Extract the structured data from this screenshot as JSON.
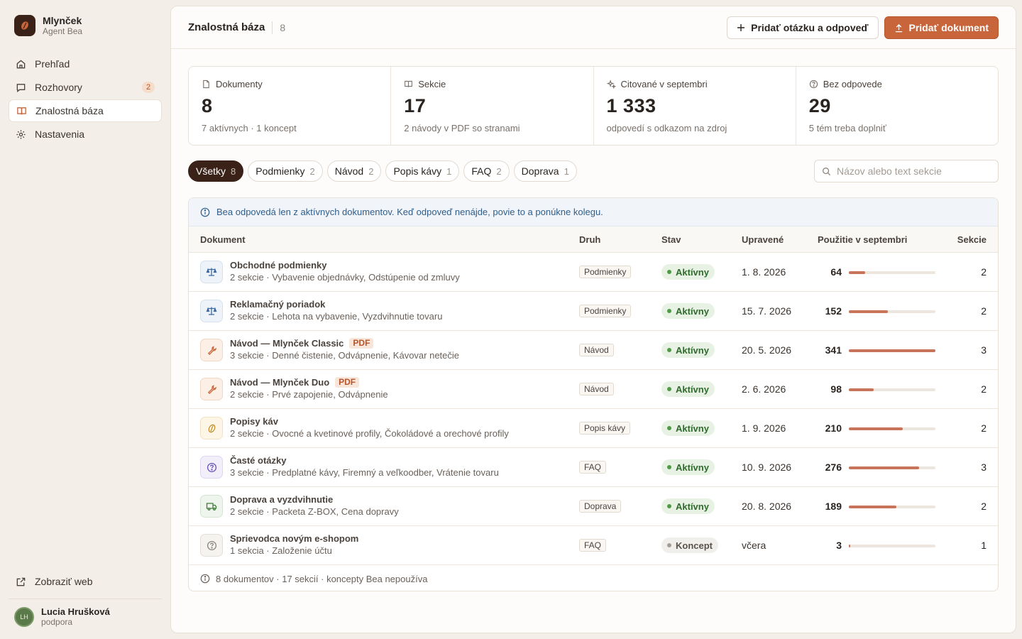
{
  "brand": {
    "name": "Mlynček",
    "sub": "Agent Bea"
  },
  "nav": [
    {
      "label": "Prehľad",
      "icon": "home-icon"
    },
    {
      "label": "Rozhovory",
      "icon": "chat-icon",
      "badge": "2"
    },
    {
      "label": "Znalostná báza",
      "icon": "book-icon",
      "active": true
    },
    {
      "label": "Nastavenia",
      "icon": "gear-icon"
    }
  ],
  "side_link": "Zobraziť web",
  "user": {
    "initials": "LH",
    "name": "Lucia Hrušková",
    "role": "podpora"
  },
  "header": {
    "title": "Znalostná báza",
    "count": "8",
    "add_qa_label": "Pridať otázku a odpoveď",
    "add_doc_label": "Pridať dokument"
  },
  "stats": [
    {
      "label": "Dokumenty",
      "value": "8",
      "sub": "7 aktívnych · 1 koncept"
    },
    {
      "label": "Sekcie",
      "value": "17",
      "sub": "2 návody v PDF so stranami"
    },
    {
      "label": "Citované v septembri",
      "value": "1 333",
      "sub": "odpovedí s odkazom na zdroj"
    },
    {
      "label": "Bez odpovede",
      "value": "29",
      "sub": "5 tém treba doplniť"
    }
  ],
  "filters": [
    {
      "label": "Všetky",
      "count": "8",
      "active": true
    },
    {
      "label": "Podmienky",
      "count": "2"
    },
    {
      "label": "Návod",
      "count": "2"
    },
    {
      "label": "Popis kávy",
      "count": "1"
    },
    {
      "label": "FAQ",
      "count": "2"
    },
    {
      "label": "Doprava",
      "count": "1"
    }
  ],
  "search": {
    "placeholder": "Názov alebo text sekcie"
  },
  "notice": "Bea odpovedá len z aktívnych dokumentov. Keď odpoveď nenájde, povie to a ponúkne kolegu.",
  "table": {
    "headers": {
      "doc": "Dokument",
      "kind": "Druh",
      "state": "Stav",
      "updated": "Upravené",
      "usage": "Použitie v septembri",
      "sections": "Sekcie"
    },
    "max_usage": 341,
    "rows": [
      {
        "title": "Obchodné podmienky",
        "sub": "2 sekcie · Vybavenie objednávky, Odstúpenie od zmluvy",
        "icon": "scale-icon",
        "color": "blue",
        "kind": "Podmienky",
        "state": "Aktívny",
        "active": true,
        "updated": "1. 8. 2026",
        "usage": 64,
        "sections": "2"
      },
      {
        "title": "Reklamačný poriadok",
        "sub": "2 sekcie · Lehota na vybavenie, Vyzdvihnutie tovaru",
        "icon": "scale-icon",
        "color": "blue",
        "kind": "Podmienky",
        "state": "Aktívny",
        "active": true,
        "updated": "15. 7. 2026",
        "usage": 152,
        "sections": "2"
      },
      {
        "title": "Návod — Mlynček Classic",
        "pdf": "PDF",
        "sub": "3 sekcie · Denné čistenie, Odvápnenie, Kávovar netečie",
        "icon": "wrench-icon",
        "color": "orange",
        "kind": "Návod",
        "state": "Aktívny",
        "active": true,
        "updated": "20. 5. 2026",
        "usage": 341,
        "sections": "3"
      },
      {
        "title": "Návod — Mlynček Duo",
        "pdf": "PDF",
        "sub": "2 sekcie · Prvé zapojenie, Odvápnenie",
        "icon": "wrench-icon",
        "color": "orange",
        "kind": "Návod",
        "state": "Aktívny",
        "active": true,
        "updated": "2. 6. 2026",
        "usage": 98,
        "sections": "2"
      },
      {
        "title": "Popisy káv",
        "sub": "2 sekcie · Ovocné a kvetinové profily, Čokoládové a orechové profily",
        "icon": "coffee-bean-icon",
        "color": "yellow",
        "kind": "Popis kávy",
        "state": "Aktívny",
        "active": true,
        "updated": "1. 9. 2026",
        "usage": 210,
        "sections": "2"
      },
      {
        "title": "Časté otázky",
        "sub": "3 sekcie · Predplatné kávy, Firemný a veľkoodber, Vrátenie tovaru",
        "icon": "question-icon",
        "color": "purple",
        "kind": "FAQ",
        "state": "Aktívny",
        "active": true,
        "updated": "10. 9. 2026",
        "usage": 276,
        "sections": "3"
      },
      {
        "title": "Doprava a vyzdvihnutie",
        "sub": "2 sekcie · Packeta Z-BOX, Cena dopravy",
        "icon": "truck-icon",
        "color": "green",
        "kind": "Doprava",
        "state": "Aktívny",
        "active": true,
        "updated": "20. 8. 2026",
        "usage": 189,
        "sections": "2"
      },
      {
        "title": "Sprievodca novým e-shopom",
        "sub": "1 sekcia · Založenie účtu",
        "icon": "question-icon",
        "color": "gray",
        "kind": "FAQ",
        "state": "Koncept",
        "active": false,
        "updated": "včera",
        "usage": 3,
        "sections": "1"
      }
    ],
    "footer": "8 dokumentov · 17 sekcií · koncepty Bea nepoužíva"
  }
}
